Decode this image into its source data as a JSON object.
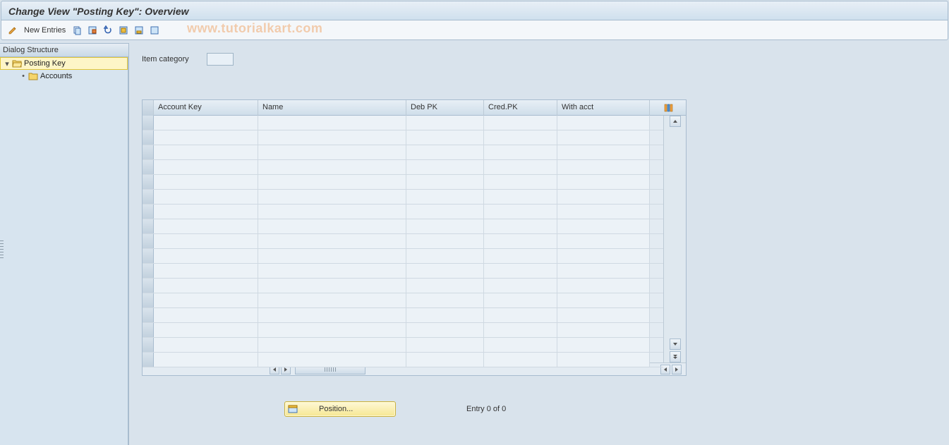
{
  "title": "Change View \"Posting Key\": Overview",
  "toolbar": {
    "new_entries": "New Entries"
  },
  "watermark": "www.tutorialkart.com",
  "sidebar": {
    "header": "Dialog Structure",
    "nodes": {
      "root": "Posting Key",
      "child": "Accounts"
    }
  },
  "field": {
    "item_category_label": "Item category",
    "item_category_value": ""
  },
  "table": {
    "col_account_key": "Account Key",
    "col_name": "Name",
    "col_deb_pk": "Deb PK",
    "col_cred_pk": "Cred.PK",
    "col_with_acct": "With acct",
    "num_rows": 17
  },
  "footer": {
    "position_label": "Position...",
    "entry_status": "Entry 0 of 0"
  }
}
